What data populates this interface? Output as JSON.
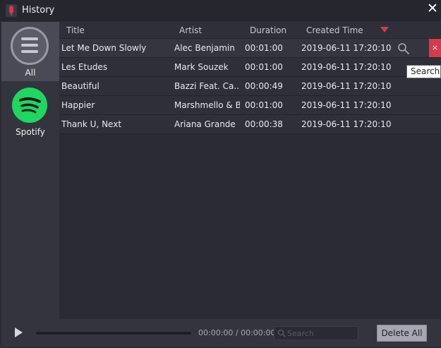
{
  "window": {
    "title": "History",
    "close_icon": "close-icon"
  },
  "sidebar": {
    "items": [
      {
        "label": "All",
        "icon": "menu-icon",
        "active": true
      },
      {
        "label": "Spotify",
        "icon": "spotify-icon",
        "active": false
      }
    ]
  },
  "table": {
    "columns": [
      "Title",
      "Artist",
      "Duration",
      "Created Time"
    ],
    "sort_indicator": "sort-desc-icon",
    "rows": [
      {
        "title": "Let Me Down Slowly",
        "artist": "Alec Benjamin",
        "duration": "00:01:00",
        "created": "2019-06-11 17:20:10"
      },
      {
        "title": "Les Etudes",
        "artist": "Mark Souzek",
        "duration": "00:01:00",
        "created": "2019-06-11 17:20:10"
      },
      {
        "title": "Beautiful",
        "artist": "Bazzi Feat. Ca...",
        "duration": "00:00:49",
        "created": "2019-06-11 17:20:10"
      },
      {
        "title": "Happier",
        "artist": "Marshmello & B...",
        "duration": "00:01:00",
        "created": "2019-06-11 17:20:10"
      },
      {
        "title": "Thank U, Next",
        "artist": "Ariana Grande",
        "duration": "00:00:38",
        "created": "2019-06-11 17:20:10"
      }
    ],
    "row_delete_label": "×",
    "tooltip": "Search"
  },
  "player": {
    "time_readout": "00:00:00 / 00:00:00",
    "progress": 0,
    "search_placeholder": "Search",
    "delete_all_label": "Delete All"
  },
  "colors": {
    "accent": "#d33a4c",
    "spotify": "#1ed760",
    "background": "#2b2b36"
  }
}
